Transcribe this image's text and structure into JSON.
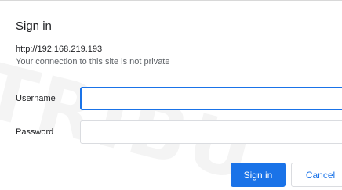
{
  "dialog": {
    "title": "Sign in",
    "url": "http://192.168.219.193",
    "warning": "Your connection to this site is not private",
    "username_label": "Username",
    "username_value": "",
    "password_label": "Password",
    "password_value": "",
    "signin_label": "Sign in",
    "cancel_label": "Cancel",
    "watermark": "TRIBU"
  },
  "colors": {
    "accent": "#1a73e8",
    "text": "#202124",
    "secondary_text": "#5f6368",
    "border": "#dadce0"
  }
}
